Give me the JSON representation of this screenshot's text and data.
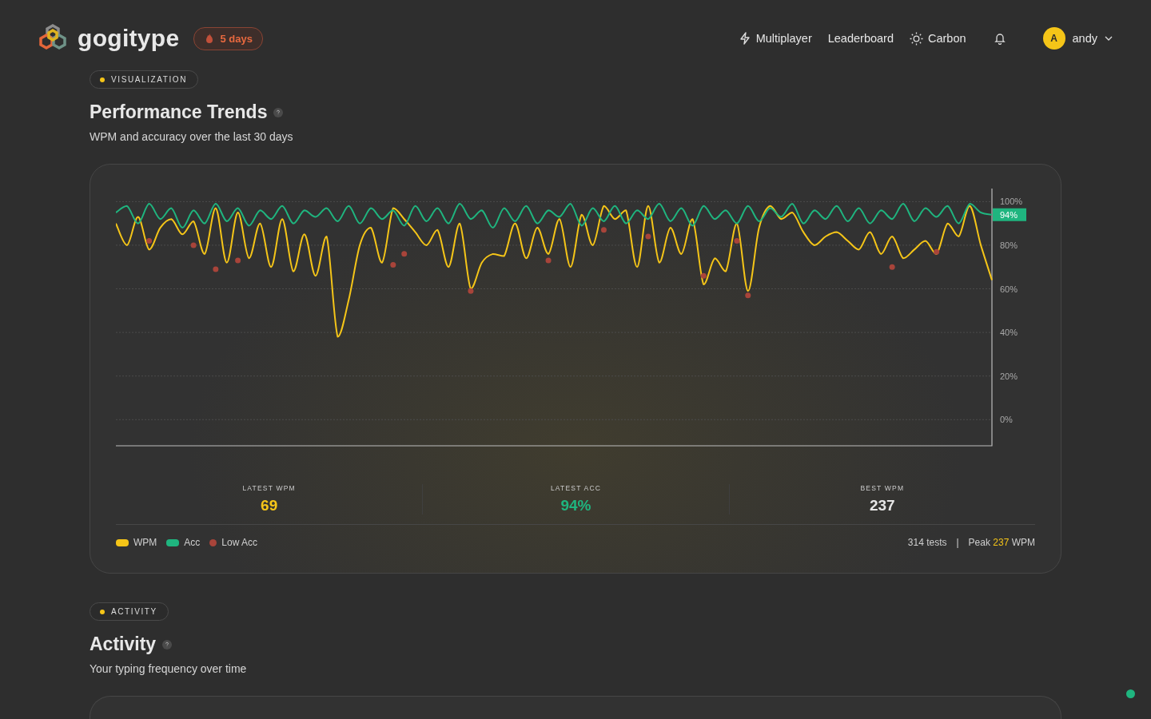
{
  "header": {
    "brand": "gogitype",
    "streak": "5 days",
    "nav": [
      {
        "label": "Multiplayer"
      },
      {
        "label": "Leaderboard"
      },
      {
        "label": "Carbon"
      }
    ],
    "user": {
      "initial": "A",
      "name": "andy"
    }
  },
  "sections": [
    {
      "tag": "VISUALIZATION",
      "title": "Performance Trends",
      "subtitle": "WPM and accuracy over the last 30 days",
      "card": {
        "kind": "trends",
        "chart_data": {
          "type": "line",
          "grid": true,
          "ylim": [
            -12,
            106
          ],
          "yticks": [
            {
              "value": 100,
              "label": "100%"
            },
            {
              "value": 80,
              "label": "80%"
            },
            {
              "value": 60,
              "label": "60%"
            },
            {
              "value": 40,
              "label": "40%"
            },
            {
              "value": 20,
              "label": "20%"
            },
            {
              "value": 0,
              "label": "0%"
            }
          ],
          "series": [
            {
              "name": "WPM",
              "type": "line",
              "color": "#f5c518",
              "values": [
                90,
                80,
                93,
                78,
                88,
                92,
                85,
                91,
                76,
                97,
                72,
                95,
                74,
                90,
                70,
                92,
                68,
                85,
                66,
                84,
                38,
                55,
                80,
                88,
                72,
                97,
                92,
                86,
                80,
                87,
                70,
                90,
                60,
                72,
                76,
                75,
                90,
                74,
                88,
                76,
                92,
                70,
                94,
                80,
                98,
                92,
                96,
                70,
                98,
                72,
                88,
                76,
                92,
                62,
                74,
                68,
                90,
                59,
                88,
                98,
                92,
                95,
                86,
                80,
                84,
                86,
                82,
                78,
                86,
                76,
                84,
                74,
                78,
                82,
                76,
                90,
                84,
                98,
                80,
                64
              ]
            },
            {
              "name": "Acc",
              "type": "line",
              "color": "#1fb57f",
              "values": [
                95,
                98,
                90,
                99,
                92,
                97,
                88,
                96,
                90,
                99,
                91,
                97,
                89,
                96,
                92,
                98,
                90,
                96,
                93,
                97,
                91,
                98,
                90,
                97,
                92,
                96,
                89,
                98,
                91,
                97,
                90,
                99,
                92,
                96,
                88,
                97,
                91,
                98,
                90,
                96,
                93,
                99,
                89,
                97,
                91,
                98,
                90,
                96,
                92,
                99,
                91,
                97,
                89,
                98,
                92,
                96,
                90,
                98,
                91,
                97,
                93,
                99,
                90,
                96,
                92,
                98,
                91,
                97,
                90,
                96,
                92,
                99,
                91,
                97,
                93,
                98,
                90,
                99,
                95,
                94
              ]
            },
            {
              "name": "Low Acc",
              "type": "scatter",
              "color": "#a8443a",
              "values": [
                null,
                null,
                null,
                82,
                null,
                null,
                null,
                80,
                null,
                69,
                null,
                73,
                null,
                null,
                null,
                null,
                null,
                null,
                null,
                null,
                null,
                null,
                null,
                null,
                null,
                71,
                76,
                null,
                null,
                null,
                null,
                null,
                59,
                null,
                null,
                null,
                null,
                null,
                null,
                73,
                null,
                null,
                null,
                null,
                87,
                null,
                null,
                null,
                84,
                null,
                null,
                null,
                null,
                66,
                null,
                null,
                82,
                57,
                null,
                null,
                null,
                null,
                null,
                null,
                null,
                null,
                null,
                null,
                null,
                null,
                70,
                null,
                null,
                null,
                77,
                null,
                null,
                null,
                null,
                null
              ]
            }
          ],
          "annotations": [
            {
              "y": 94,
              "text": "94%"
            }
          ]
        },
        "stats": [
          {
            "label": "LATEST WPM",
            "value": "69",
            "color": "#f5c518"
          },
          {
            "label": "LATEST ACC",
            "value": "94%",
            "color": "#1fb57f"
          },
          {
            "label": "BEST WPM",
            "value": "237",
            "color": "#e6e6e6"
          }
        ],
        "summary": {
          "tests": "314 tests",
          "separator": "|",
          "peak_prefix": "Peak",
          "peak_value": "237",
          "peak_suffix": "WPM"
        }
      }
    },
    {
      "tag": "ACTIVITY",
      "title": "Activity",
      "subtitle": "Your typing frequency over time",
      "card": {
        "kind": "empty"
      }
    }
  ]
}
